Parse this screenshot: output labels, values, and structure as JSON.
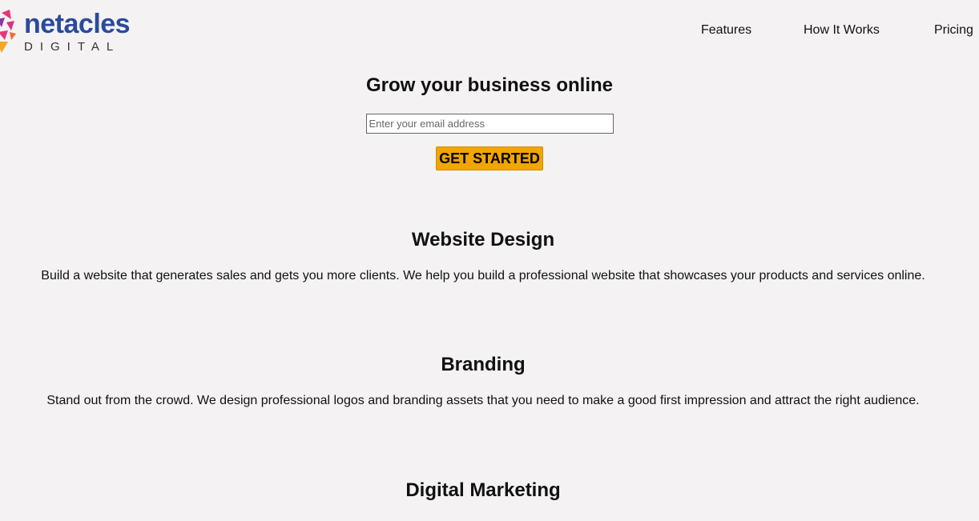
{
  "brand": {
    "name": "netacles",
    "tagline": "DIGITAL",
    "colors": {
      "word": "#2b4a9a",
      "mark1": "#e8357a",
      "mark2": "#8a3aa0",
      "mark3": "#f5a623"
    }
  },
  "nav": {
    "items": [
      {
        "label": "Features"
      },
      {
        "label": "How It Works"
      },
      {
        "label": "Pricing"
      }
    ]
  },
  "hero": {
    "title": "Grow your business online",
    "email_placeholder": "Enter your email address",
    "cta_label": "GET STARTED",
    "cta_color": "#f0a500"
  },
  "features": [
    {
      "title": "Website Design",
      "text": "Build a website that generates sales and gets you more clients. We help you build a professional website that showcases your products and services online."
    },
    {
      "title": "Branding",
      "text": "Stand out from the crowd. We design professional logos and branding assets that you need to make a good first impression and attract the right audience."
    },
    {
      "title": "Digital Marketing"
    }
  ]
}
